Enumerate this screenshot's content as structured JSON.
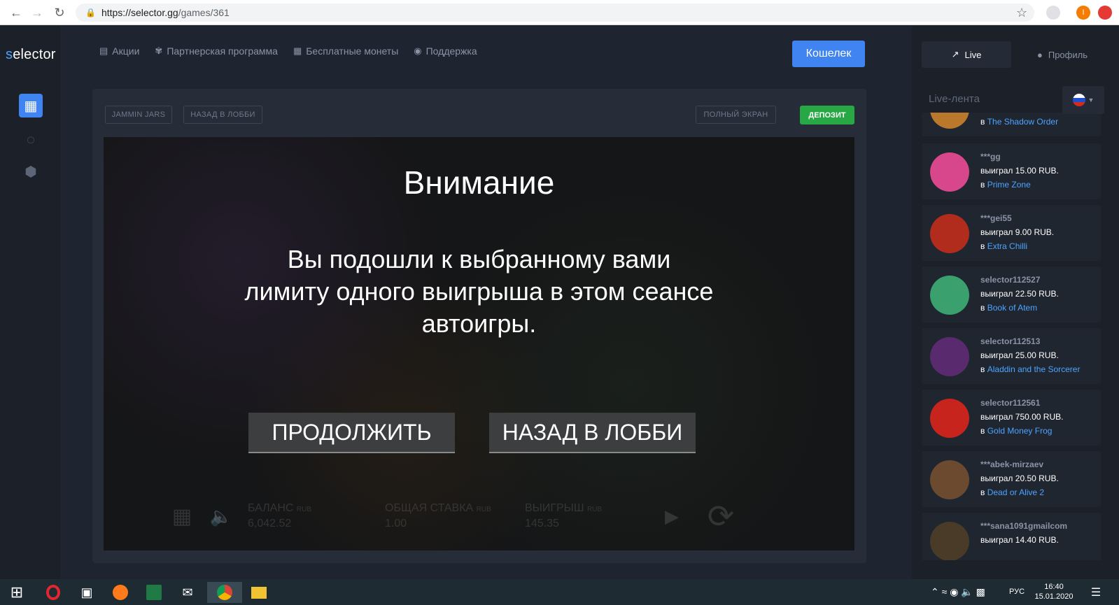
{
  "browser": {
    "url_host": "https://selector.gg",
    "url_path": "/games/361",
    "profile_letter": "I"
  },
  "app": {
    "logo": "selector",
    "nav": [
      {
        "label": "Акции",
        "icon": "news-icon"
      },
      {
        "label": "Партнерская программа",
        "icon": "partner-icon"
      },
      {
        "label": "Бесплатные монеты",
        "icon": "gift-icon"
      },
      {
        "label": "Поддержка",
        "icon": "headset-icon"
      }
    ],
    "wallet_label": "Кошелек",
    "rail": [
      "slots-icon",
      "roulette-icon",
      "cube-icon"
    ]
  },
  "panel": {
    "game_name": "JAMMIN JARS",
    "back_lobby": "НАЗАД В ЛОББИ",
    "fullscreen": "ПОЛНЫЙ ЭКРАН",
    "deposit": "ДЕПОЗИТ"
  },
  "game": {
    "title": "Внимание",
    "message": "Вы подошли к выбранному вами лимиту одного выигрыша в этом сеансе автоигры.",
    "continue": "ПРОДОЛЖИТЬ",
    "back": "НАЗАД В ЛОББИ",
    "hud": {
      "balance_label": "БАЛАНС",
      "balance_currency": "RUB",
      "balance_value": "6,042.52",
      "bet_label": "ОБЩАЯ СТАВКА",
      "bet_currency": "RUB",
      "bet_value": "1.00",
      "win_label": "ВЫИГРЫШ",
      "win_currency": "RUB",
      "win_value": "145.35"
    }
  },
  "sidebar": {
    "tab_live": "Live",
    "tab_profile": "Профиль",
    "feed_title": "Live-лента",
    "feed": [
      {
        "user": "",
        "amount": "",
        "prefix": "в",
        "game": "The Shadow Order",
        "color": "#b9782c"
      },
      {
        "user": "***gg",
        "amount": "выиграл 15.00 RUB.",
        "prefix": "в",
        "game": "Prime Zone",
        "color": "#d8478c"
      },
      {
        "user": "***gei55",
        "amount": "выиграл 9.00 RUB.",
        "prefix": "в",
        "game": "Extra Chilli",
        "color": "#b22c1e"
      },
      {
        "user": "selector112527",
        "amount": "выиграл 22.50 RUB.",
        "prefix": "в",
        "game": "Book of Atem",
        "color": "#3aa06e"
      },
      {
        "user": "selector112513",
        "amount": "выиграл 25.00 RUB.",
        "prefix": "в",
        "game": "Aladdin and the Sorcerer",
        "color": "#5a2a6e"
      },
      {
        "user": "selector112561",
        "amount": "выиграл 750.00 RUB.",
        "prefix": "в",
        "game": "Gold Money Frog",
        "color": "#c8241e"
      },
      {
        "user": "***abek-mirzaev",
        "amount": "выиграл 20.50 RUB.",
        "prefix": "в",
        "game": "Dead or Alive 2",
        "color": "#6b4a2f"
      },
      {
        "user": "***sana1091gmailcom",
        "amount": "выиграл 14.40 RUB.",
        "prefix": "",
        "game": "",
        "color": "#4a3a28"
      }
    ]
  },
  "taskbar": {
    "time": "16:40",
    "date": "15.01.2020",
    "lang": "РУС"
  }
}
